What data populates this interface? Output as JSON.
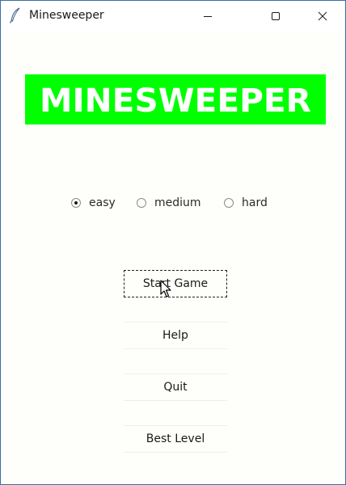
{
  "window": {
    "title": "Minesweeper",
    "icon": "feather-icon",
    "controls": [
      "minimize-icon",
      "maximize-icon",
      "close-icon"
    ]
  },
  "banner": {
    "text": "MINESWEEPER",
    "background_color": "#00ff00",
    "text_color": "#ffffff"
  },
  "difficulty": {
    "options": [
      {
        "label": "easy",
        "selected": true
      },
      {
        "label": "medium",
        "selected": false
      },
      {
        "label": "hard",
        "selected": false
      }
    ]
  },
  "menu": {
    "start_label": "Start Game",
    "help_label": "Help",
    "quit_label": "Quit",
    "best_label": "Best Level"
  }
}
